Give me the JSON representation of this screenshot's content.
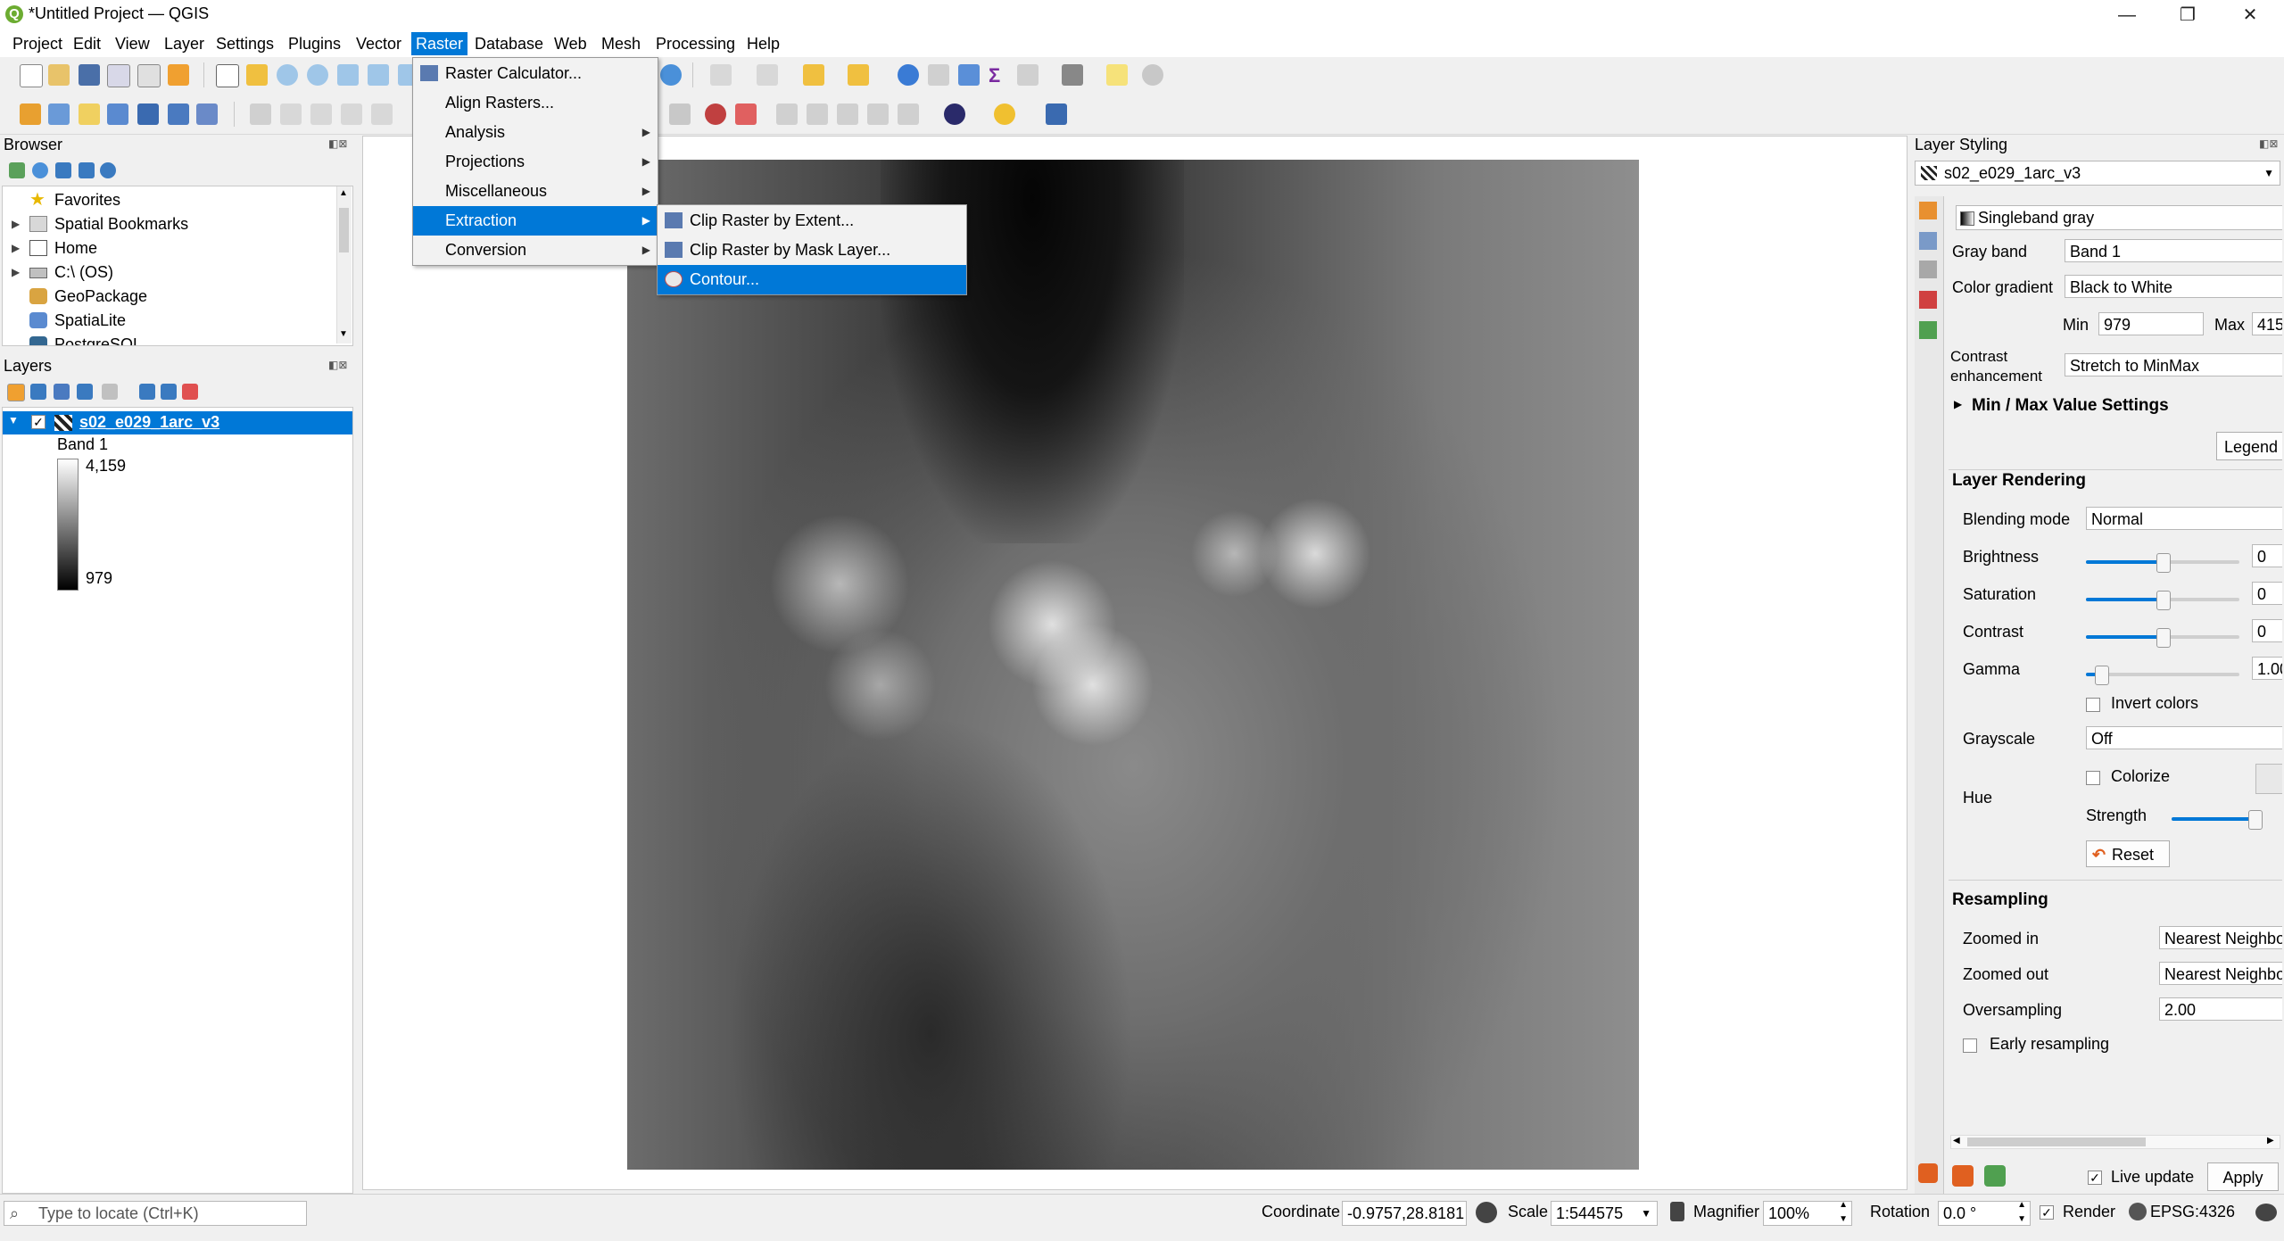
{
  "window": {
    "title": "*Untitled Project — QGIS",
    "logo_letter": "Q",
    "minimize": "—",
    "maximize": "❐",
    "close": "✕"
  },
  "menubar": [
    "Project",
    "Edit",
    "View",
    "Layer",
    "Settings",
    "Plugins",
    "Vector",
    "Raster",
    "Database",
    "Web",
    "Mesh",
    "Processing",
    "Help"
  ],
  "raster_menu": {
    "items": [
      "Raster Calculator...",
      "Align Rasters...",
      "Analysis",
      "Projections",
      "Miscellaneous",
      "Extraction",
      "Conversion"
    ],
    "highlighted": "Extraction"
  },
  "extraction_submenu": {
    "items": [
      "Clip Raster by Extent...",
      "Clip Raster by Mask Layer...",
      "Contour..."
    ],
    "highlighted": "Contour..."
  },
  "browser": {
    "title": "Browser",
    "items": [
      "Favorites",
      "Spatial Bookmarks",
      "Home",
      "C:\\ (OS)",
      "GeoPackage",
      "SpatiaLite",
      "PostgreSQL"
    ]
  },
  "layers": {
    "title": "Layers",
    "layer_name": "s02_e029_1arc_v3",
    "band": "Band 1",
    "max": "4,159",
    "min": "979"
  },
  "styling": {
    "title": "Layer Styling",
    "layer_select": "s02_e029_1arc_v3",
    "renderer": "Singleband gray",
    "gray_band_label": "Gray band",
    "gray_band": "Band 1",
    "color_gradient_label": "Color gradient",
    "color_gradient": "Black to White",
    "min_label": "Min",
    "min": "979",
    "max_label": "Max",
    "max": "415",
    "contrast_label_1": "Contrast",
    "contrast_label_2": "enhancement",
    "contrast": "Stretch to MinMax",
    "minmax_section": "Min / Max Value Settings",
    "legend_button": "Legend",
    "layer_rendering": "Layer Rendering",
    "blending_label": "Blending mode",
    "blending": "Normal",
    "brightness_label": "Brightness",
    "brightness": "0",
    "brightness_level": 0.5,
    "saturation_label": "Saturation",
    "saturation": "0",
    "saturation_level": 0.5,
    "contrast2_label": "Contrast",
    "contrast2": "0",
    "contrast2_level": 0.5,
    "gamma_label": "Gamma",
    "gamma": "1.00",
    "gamma_level": 0.1,
    "invert_label": "Invert colors",
    "grayscale_label": "Grayscale",
    "grayscale": "Off",
    "hue_label": "Hue",
    "colorize_label": "Colorize",
    "strength_label": "Strength",
    "strength_level": 0.93,
    "reset_label": "Reset",
    "resampling": "Resampling",
    "zoomed_in_label": "Zoomed in",
    "zoomed_in": "Nearest Neighbour",
    "zoomed_out_label": "Zoomed out",
    "zoomed_out": "Nearest Neighbour",
    "oversampling_label": "Oversampling",
    "oversampling": "2.00",
    "early_label": "Early resampling",
    "live_update_label": "Live update",
    "apply_label": "Apply"
  },
  "statusbar": {
    "locate_placeholder": "Type to locate (Ctrl+K)",
    "coordinate_label": "Coordinate",
    "coordinate": "-0.9757,28.8181",
    "scale_label": "Scale",
    "scale": "1:544575",
    "magnifier_label": "Magnifier",
    "magnifier": "100%",
    "rotation_label": "Rotation",
    "rotation": "0.0 °",
    "render_label": "Render",
    "crs": "EPSG:4326"
  },
  "colors": {
    "selection": "#0078d7",
    "qgis_green": "#6cac31"
  }
}
